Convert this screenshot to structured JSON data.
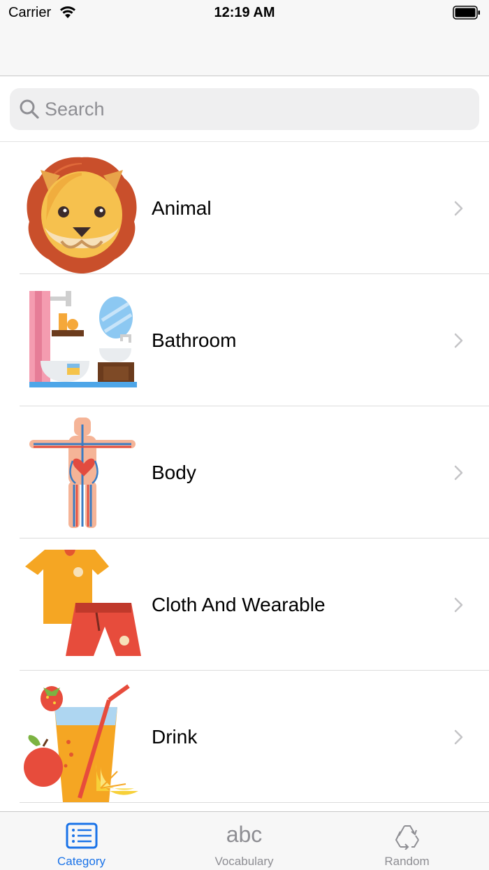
{
  "status_bar": {
    "carrier": "Carrier",
    "time": "12:19 AM"
  },
  "search": {
    "placeholder": "Search",
    "value": ""
  },
  "categories": [
    {
      "label": "Animal",
      "icon": "lion-icon"
    },
    {
      "label": "Bathroom",
      "icon": "bathroom-icon"
    },
    {
      "label": "Body",
      "icon": "body-icon"
    },
    {
      "label": "Cloth And Wearable",
      "icon": "clothes-icon"
    },
    {
      "label": "Drink",
      "icon": "drink-icon"
    }
  ],
  "tab_bar": {
    "tabs": [
      {
        "label": "Category",
        "icon": "list-icon",
        "active": true
      },
      {
        "label": "Vocabulary",
        "icon": "abc-icon",
        "glyph": "abc",
        "active": false
      },
      {
        "label": "Random",
        "icon": "recycle-icon",
        "active": false
      }
    ]
  },
  "colors": {
    "accent": "#1a73e8",
    "inactive": "#8e8e93",
    "bar_background": "#f7f7f7",
    "search_background": "#efeff0"
  }
}
